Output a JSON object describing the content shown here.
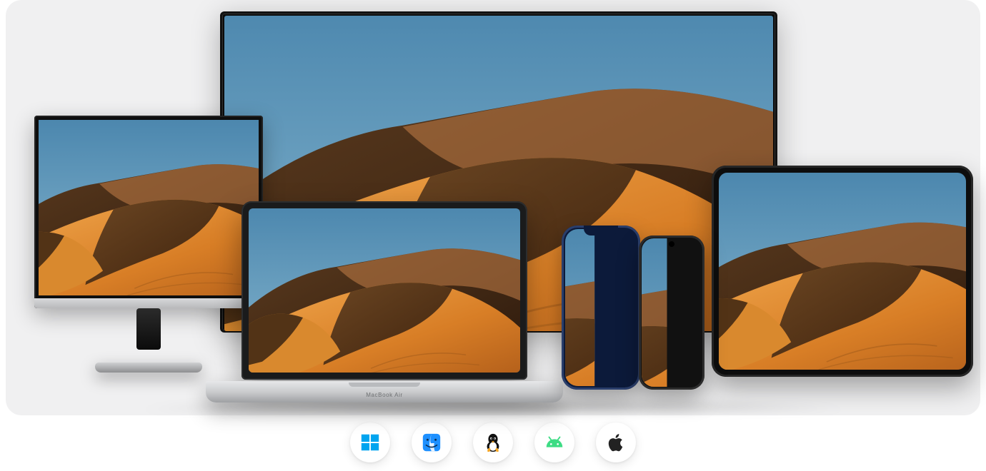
{
  "laptop": {
    "brand_label": "MacBook Air"
  },
  "devices": [
    {
      "name": "tv",
      "type": "television"
    },
    {
      "name": "monitor",
      "type": "desktop-monitor"
    },
    {
      "name": "laptop",
      "type": "laptop"
    },
    {
      "name": "phone-1",
      "type": "smartphone"
    },
    {
      "name": "phone-2",
      "type": "smartphone"
    },
    {
      "name": "tablet",
      "type": "tablet"
    }
  ],
  "platforms": [
    {
      "name": "windows",
      "color": "#00A4EF"
    },
    {
      "name": "macos",
      "color": "#1E90FF"
    },
    {
      "name": "linux",
      "color": "#000000"
    },
    {
      "name": "android",
      "color": "#3DDC84"
    },
    {
      "name": "ios",
      "color": "#222222"
    }
  ],
  "wallpaper": {
    "description": "desert sand dunes under clear blue sky",
    "sky_color": "#5C94B7",
    "dune_highlight": "#E08A2F",
    "dune_mid": "#B4601B",
    "dune_shadow": "#3B2514"
  }
}
